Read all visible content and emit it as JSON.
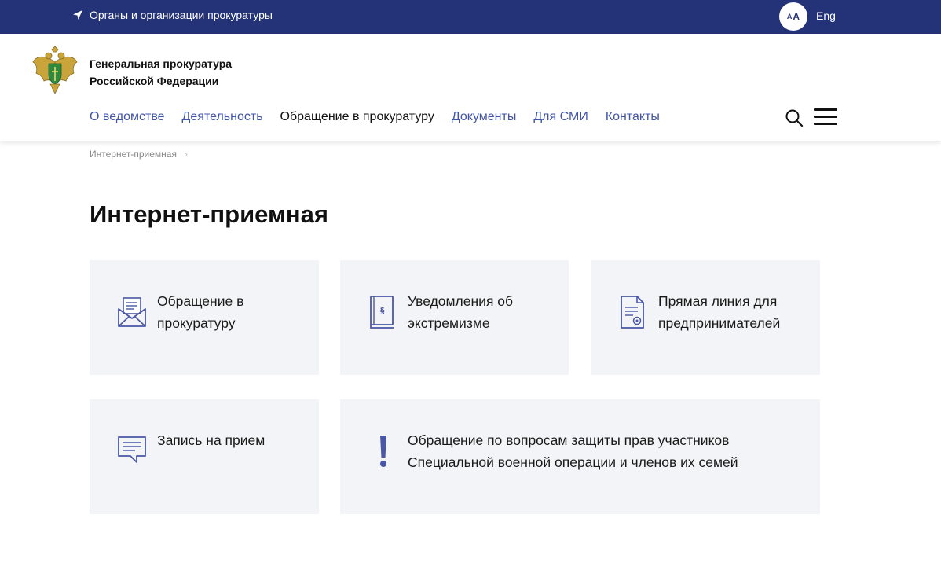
{
  "topbar": {
    "organs_link": "Органы и организации прокуратуры",
    "font_size_small": "A",
    "font_size_large": "A",
    "lang_link": "Eng"
  },
  "header": {
    "org_name_line1": "Генеральная прокуратура",
    "org_name_line2": "Российской Федерации",
    "nav": [
      {
        "label": "О ведомстве"
      },
      {
        "label": "Деятельность"
      },
      {
        "label": "Обращение в прокуратуру",
        "active": true
      },
      {
        "label": "Документы"
      },
      {
        "label": "Для СМИ"
      },
      {
        "label": "Контакты"
      }
    ]
  },
  "breadcrumb": {
    "current": "Интернет-приемная",
    "separator": "›"
  },
  "page": {
    "title": "Интернет-приемная"
  },
  "cards": [
    {
      "icon": "envelope-letter-icon",
      "text": "Обращение в прокуратуру"
    },
    {
      "icon": "law-book-icon",
      "text": "Уведомления об экстремизме"
    },
    {
      "icon": "document-seal-icon",
      "text": "Прямая линия для предпринимателей"
    },
    {
      "icon": "chat-bubble-icon",
      "text": "Запись на прием"
    },
    {
      "icon": "exclamation-icon",
      "text": "Обращение по вопросам защиты прав участников Специальной военной операции и членов их семей"
    }
  ],
  "colors": {
    "topbar_bg": "#243278",
    "accent": "#4055a8",
    "card_bg": "#f3f4f7",
    "icon": "#4a56a6"
  }
}
